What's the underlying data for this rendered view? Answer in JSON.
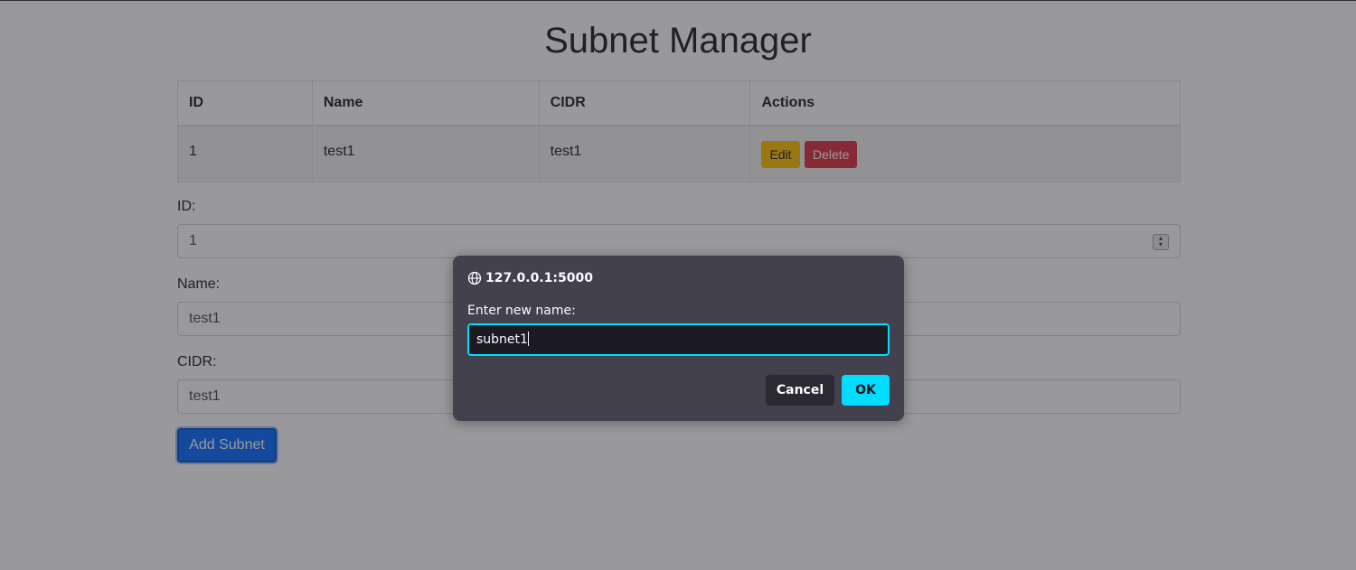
{
  "page": {
    "title": "Subnet Manager"
  },
  "table": {
    "headers": [
      "ID",
      "Name",
      "CIDR",
      "Actions"
    ],
    "rows": [
      {
        "id": "1",
        "name": "test1",
        "cidr": "test1",
        "edit_label": "Edit",
        "delete_label": "Delete"
      }
    ]
  },
  "form": {
    "id_label": "ID:",
    "id_value": "1",
    "name_label": "Name:",
    "name_value": "test1",
    "cidr_label": "CIDR:",
    "cidr_value": "test1",
    "submit_label": "Add Subnet"
  },
  "dialog": {
    "origin": "127.0.0.1:5000",
    "message": "Enter new name:",
    "input_value": "subnet1",
    "cancel_label": "Cancel",
    "ok_label": "OK"
  },
  "colors": {
    "edit_button": "#ffc107",
    "delete_button": "#dc3545",
    "primary_button": "#0d6efd",
    "dialog_background": "#42414d",
    "dialog_accent": "#00ddff"
  },
  "icons": {
    "origin": "globe-icon",
    "number_spinner": "spinner-arrows-icon"
  }
}
